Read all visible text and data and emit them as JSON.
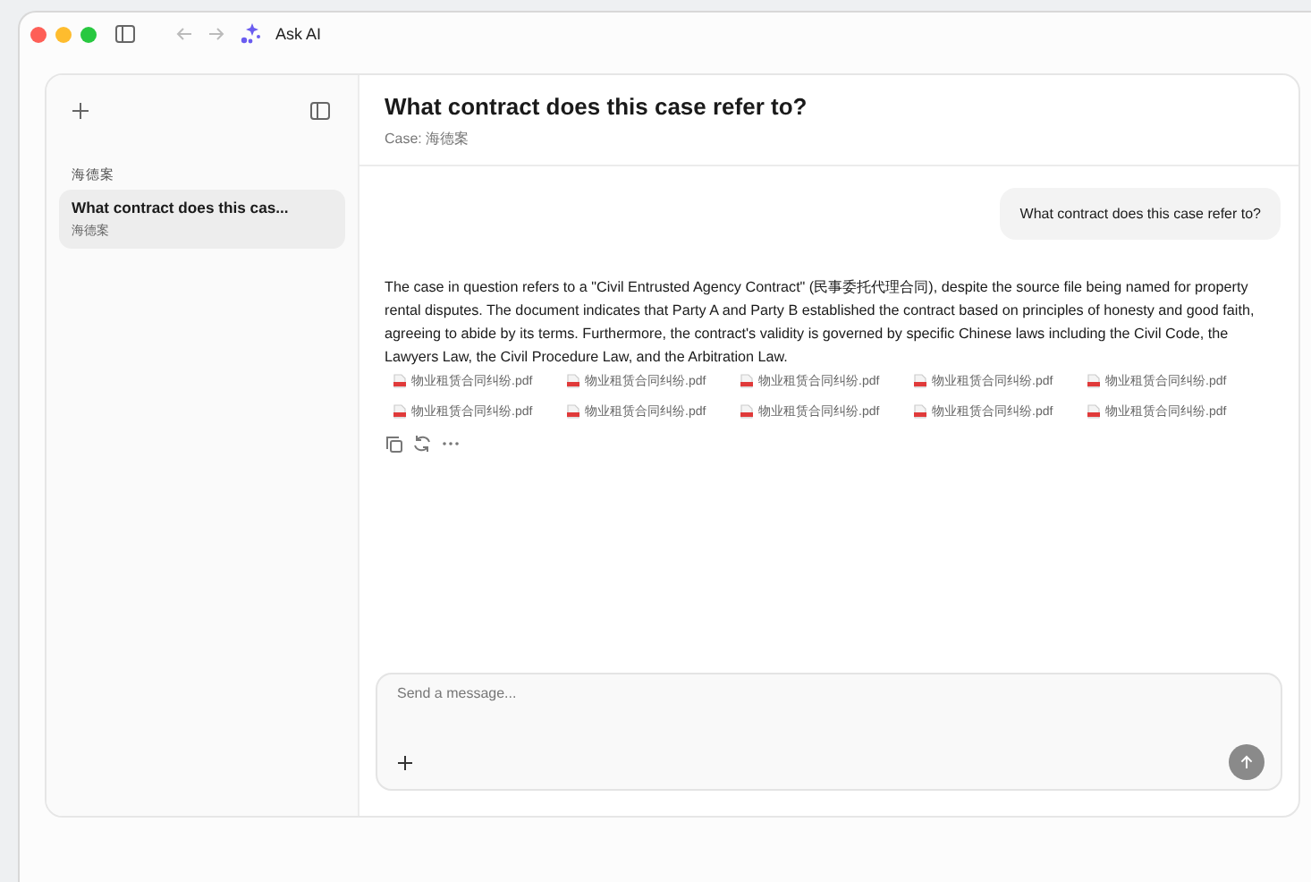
{
  "window": {
    "title": "Ask AI"
  },
  "sidebar": {
    "groups": [
      {
        "label": "海德案",
        "items": [
          {
            "title": "What contract does this cas...",
            "subtitle": "海德案",
            "selected": true
          }
        ]
      }
    ]
  },
  "chat": {
    "title": "What contract does this case refer to?",
    "subtitle": "Case: 海德案",
    "messages": [
      {
        "kind": "user",
        "text": "What contract does this case refer to?"
      },
      {
        "kind": "assistant",
        "text": "The case in question refers to a \"Civil Entrusted Agency Contract\" (民事委托代理合同), despite the source file being named for property rental disputes. The document indicates that Party A and Party B established the contract based on principles of honesty and good faith, agreeing to abide by its terms. Furthermore, the contract's validity is governed by specific Chinese laws including the Civil Code, the Lawyers Law, the Civil Procedure Law, and the Arbitration Law.",
        "sources": [
          "物业租赁合同纠纷.pdf",
          "物业租赁合同纠纷.pdf",
          "物业租赁合同纠纷.pdf",
          "物业租赁合同纠纷.pdf",
          "物业租赁合同纠纷.pdf",
          "物业租赁合同纠纷.pdf",
          "物业租赁合同纠纷.pdf",
          "物业租赁合同纠纷.pdf",
          "物业租赁合同纠纷.pdf",
          "物业租赁合同纠纷.pdf"
        ],
        "actions": [
          {
            "kind": "copy"
          },
          {
            "kind": "regenerate"
          },
          {
            "kind": "more"
          }
        ]
      }
    ]
  },
  "composer": {
    "placeholder": "Send a message..."
  }
}
